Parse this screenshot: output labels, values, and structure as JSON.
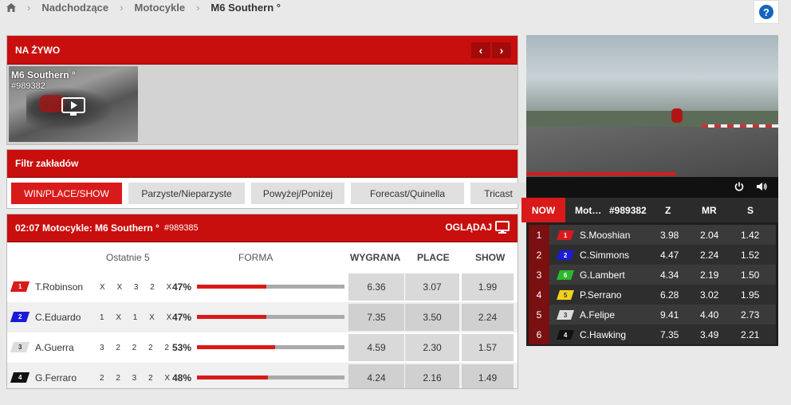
{
  "breadcrumb": {
    "items": [
      "Nadchodzące",
      "Motocykle",
      "M6 Southern °"
    ]
  },
  "live": {
    "title": "NA ŻYWO",
    "thumb_title": "M6 Southern °",
    "thumb_id": "#989382"
  },
  "filter": {
    "title": "Filtr zakładów",
    "tabs": [
      "WIN/PLACE/SHOW",
      "Parzyste/Nieparzyste",
      "Powyżej/Poniżej",
      "Forecast/Quinella",
      "Tricast"
    ]
  },
  "race": {
    "title": "02:07 Motocykle: M6 Southern °",
    "id": "#989385",
    "watch_label": "OGLĄDAJ",
    "columns": {
      "last5": "Ostatnie 5",
      "form": "FORMA",
      "win": "WYGRANA",
      "place": "PLACE",
      "show": "SHOW"
    },
    "runners": [
      {
        "num": "1",
        "name": "T.Robinson",
        "last5": "X X 3 2 X",
        "form_pct": "47%",
        "form_value": 47,
        "win": "6.36",
        "place": "3.07",
        "show": "1.99",
        "color": "#d91a1a",
        "text_color": "#ffffff"
      },
      {
        "num": "2",
        "name": "C.Eduardo",
        "last5": "1 X 1 X X",
        "form_pct": "47%",
        "form_value": 47,
        "win": "7.35",
        "place": "3.50",
        "show": "2.24",
        "color": "#1a1ad9",
        "text_color": "#ffffff"
      },
      {
        "num": "3",
        "name": "A.Guerra",
        "last5": "3 2 2 2 2",
        "form_pct": "53%",
        "form_value": 53,
        "win": "4.59",
        "place": "2.30",
        "show": "1.57",
        "color": "#dddddd",
        "text_color": "#333333"
      },
      {
        "num": "4",
        "name": "G.Ferraro",
        "last5": "2 2 3 2 X",
        "form_pct": "48%",
        "form_value": 48,
        "win": "4.24",
        "place": "2.16",
        "show": "1.49",
        "color": "#111111",
        "text_color": "#ffffff"
      }
    ]
  },
  "board": {
    "now_label": "NOW",
    "sport_label": "Mot…",
    "event_id": "#989382",
    "col_z": "Z",
    "col_mr": "MR",
    "col_s": "S",
    "rows": [
      {
        "pos": "1",
        "num": "1",
        "name": "S.Mooshian",
        "z": "3.98",
        "mr": "2.04",
        "s": "1.42",
        "color": "#d91a1a",
        "text_color": "#ffffff"
      },
      {
        "pos": "2",
        "num": "2",
        "name": "C.Simmons",
        "z": "4.47",
        "mr": "2.24",
        "s": "1.52",
        "color": "#1a1ad9",
        "text_color": "#ffffff"
      },
      {
        "pos": "3",
        "num": "6",
        "name": "G.Lambert",
        "z": "4.34",
        "mr": "2.19",
        "s": "1.50",
        "color": "#2db82d",
        "text_color": "#ffffff"
      },
      {
        "pos": "4",
        "num": "5",
        "name": "P.Serrano",
        "z": "6.28",
        "mr": "3.02",
        "s": "1.95",
        "color": "#f2d21a",
        "text_color": "#333333"
      },
      {
        "pos": "5",
        "num": "3",
        "name": "A.Felipe",
        "z": "9.41",
        "mr": "4.40",
        "s": "2.73",
        "color": "#dddddd",
        "text_color": "#333333"
      },
      {
        "pos": "6",
        "num": "4",
        "name": "C.Hawking",
        "z": "7.35",
        "mr": "3.49",
        "s": "2.21",
        "color": "#111111",
        "text_color": "#ffffff"
      }
    ]
  },
  "icons": [
    "home-icon",
    "help-icon",
    "chevron-left-icon",
    "chevron-right-icon",
    "play-icon",
    "monitor-icon",
    "power-icon",
    "volume-icon"
  ],
  "colors": {
    "accent": "#c90e0e",
    "active_tab": "#d91a1a",
    "help": "#1565c0"
  }
}
